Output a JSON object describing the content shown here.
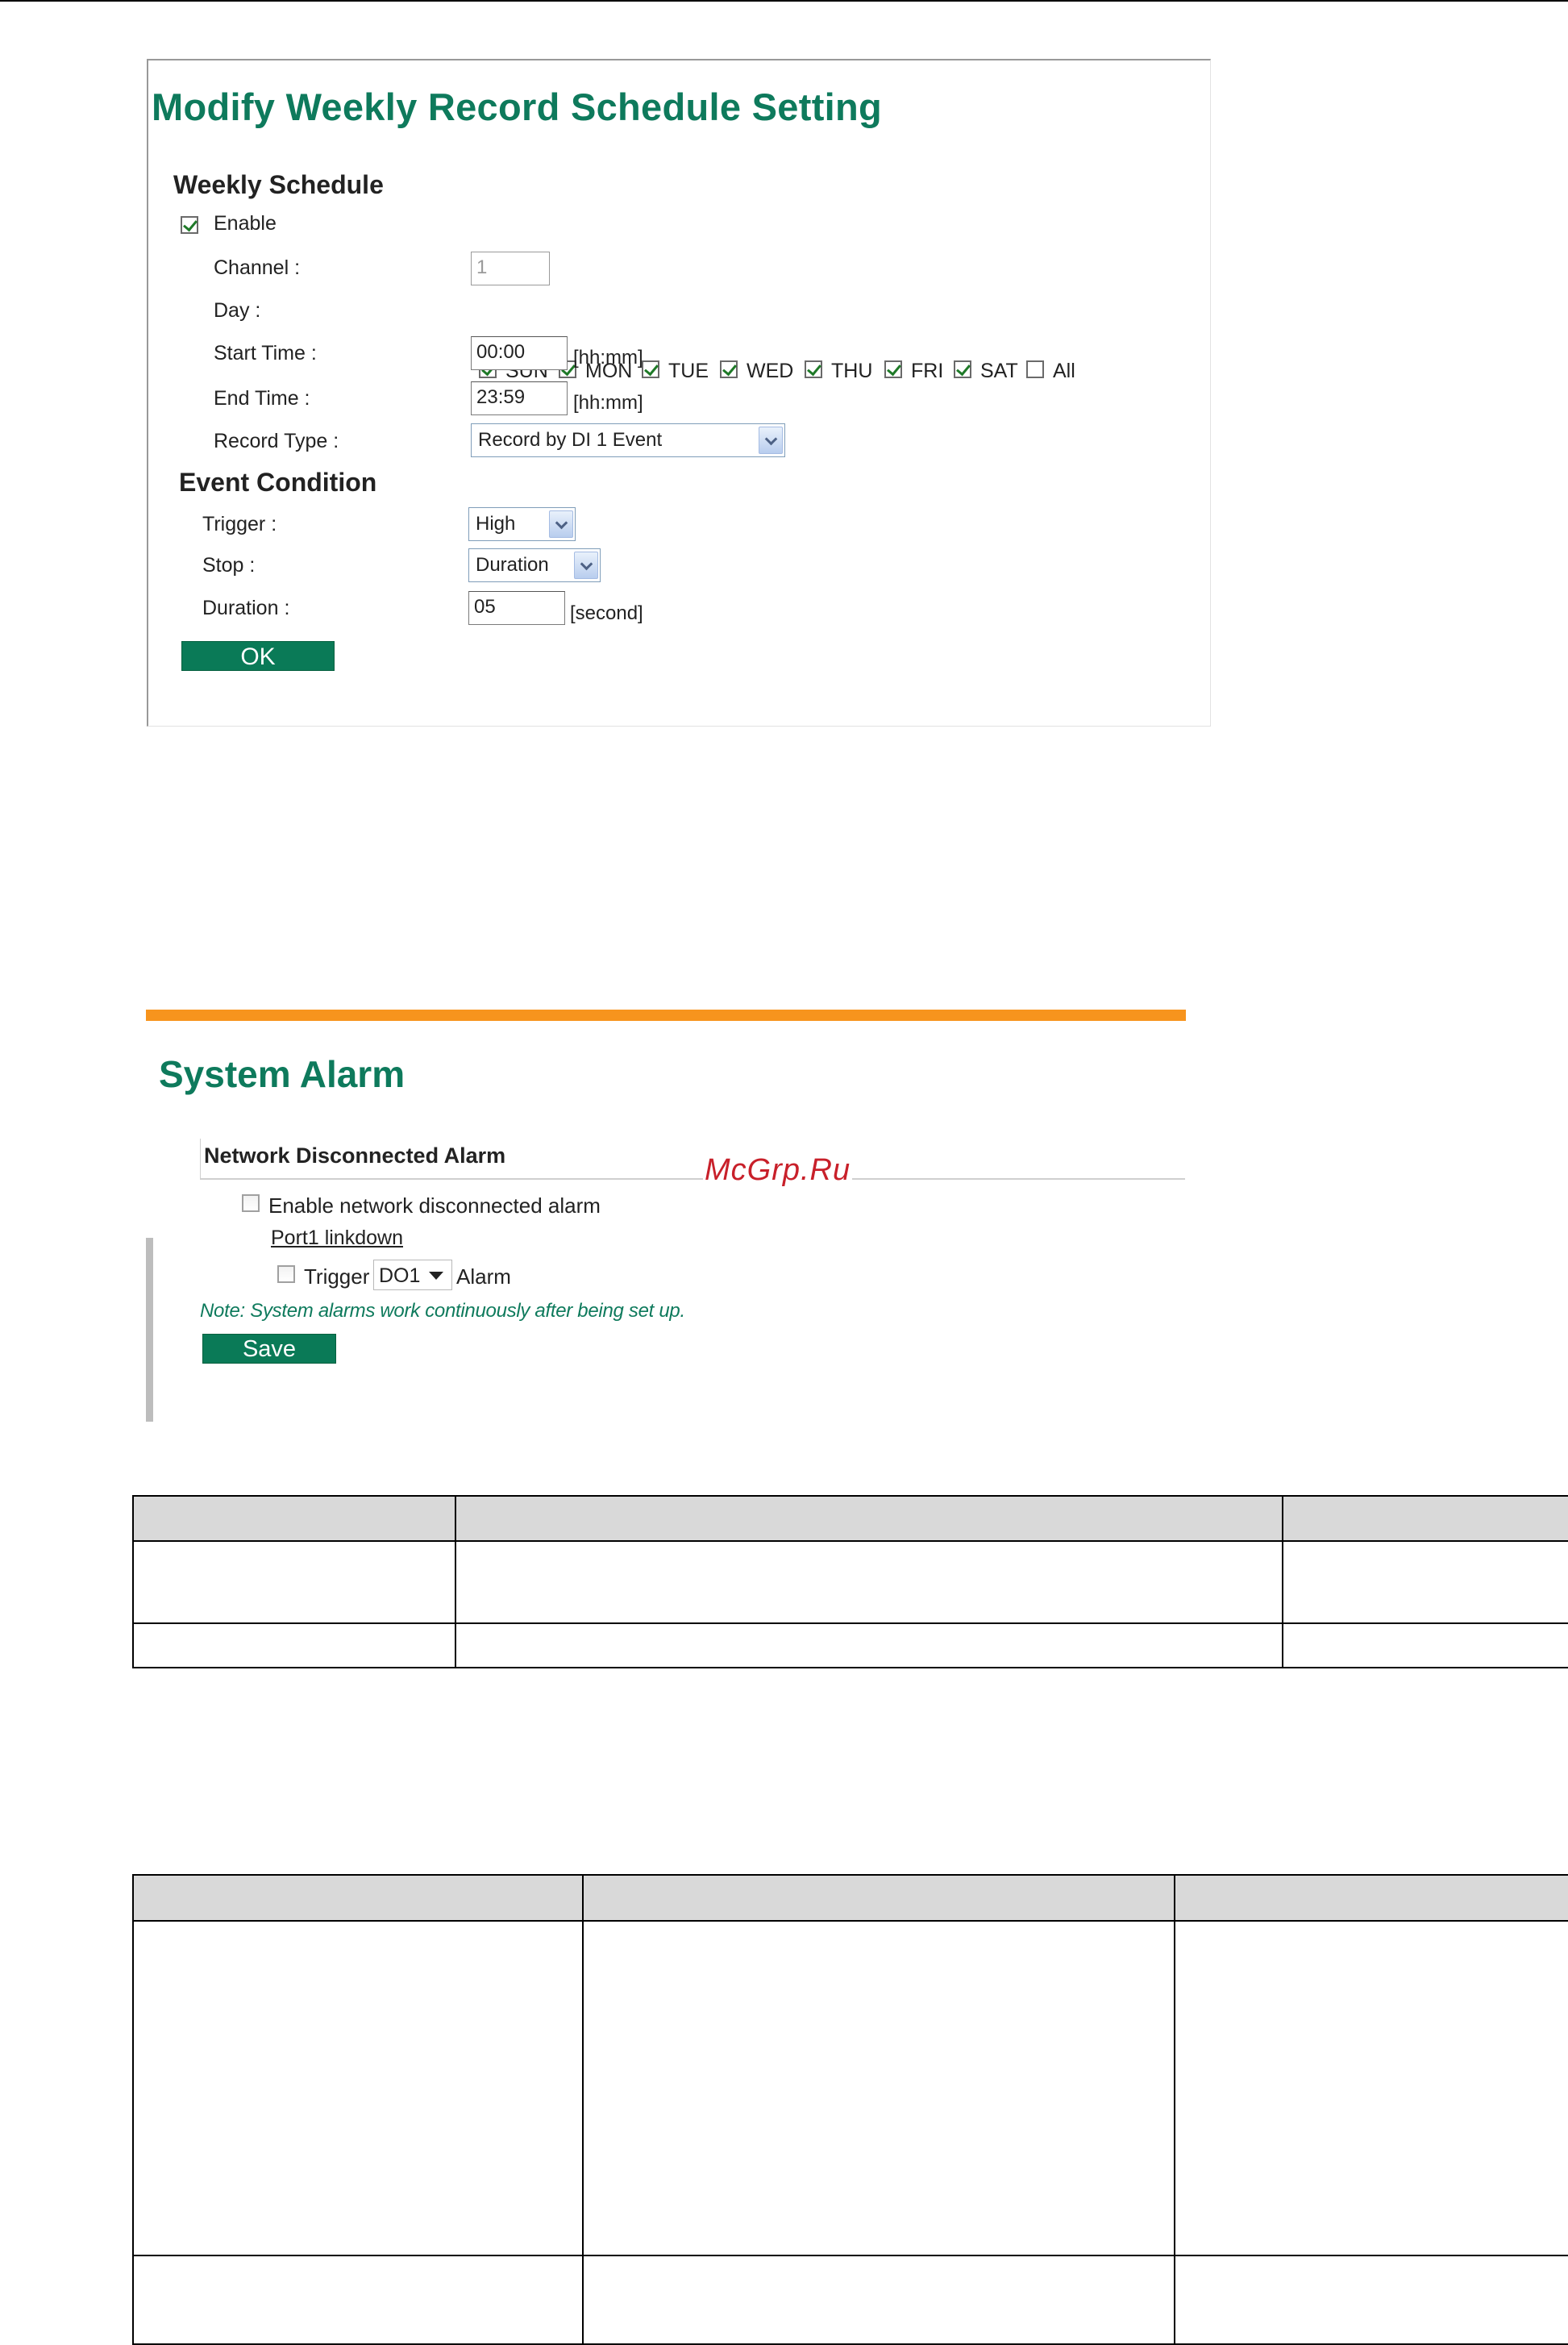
{
  "schedule_panel": {
    "title": "Modify Weekly Record Schedule Setting",
    "weekly_schedule_heading": "Weekly Schedule",
    "enable_label": "Enable",
    "enable_checked": true,
    "channel_label": "Channel :",
    "channel_value": "1",
    "day_label": "Day :",
    "days": [
      {
        "label": "SUN",
        "checked": true
      },
      {
        "label": "MON",
        "checked": true
      },
      {
        "label": "TUE",
        "checked": true
      },
      {
        "label": "WED",
        "checked": true
      },
      {
        "label": "THU",
        "checked": true
      },
      {
        "label": "FRI",
        "checked": true
      },
      {
        "label": "SAT",
        "checked": true
      },
      {
        "label": "All",
        "checked": false
      }
    ],
    "start_time_label": "Start Time :",
    "start_time_value": "00:00",
    "start_time_unit": "[hh:mm]",
    "end_time_label": "End Time :",
    "end_time_value": "23:59",
    "end_time_unit": "[hh:mm]",
    "record_type_label": "Record Type :",
    "record_type_value": "Record by DI 1 Event",
    "event_condition_heading": "Event Condition",
    "trigger_label": "Trigger :",
    "trigger_value": "High",
    "stop_label": "Stop :",
    "stop_value": "Duration",
    "duration_label": "Duration :",
    "duration_value": "05",
    "duration_unit": "[second]",
    "ok_label": "OK"
  },
  "alarm_panel": {
    "title": "System Alarm",
    "section_heading": "Network Disconnected Alarm",
    "enable_label": "Enable network disconnected alarm",
    "enable_checked": false,
    "port_link": "Port1 linkdown",
    "trigger_label": "Trigger",
    "trigger_checked": false,
    "do_value": "DO1",
    "alarm_label": "Alarm",
    "note": "Note: System alarms work continuously after being set up.",
    "save_label": "Save"
  },
  "watermark": "McGrp.Ru",
  "colors": {
    "title_green": "#0e7a5c",
    "button_green": "#0a7a57",
    "accent_orange": "#f7941d"
  }
}
